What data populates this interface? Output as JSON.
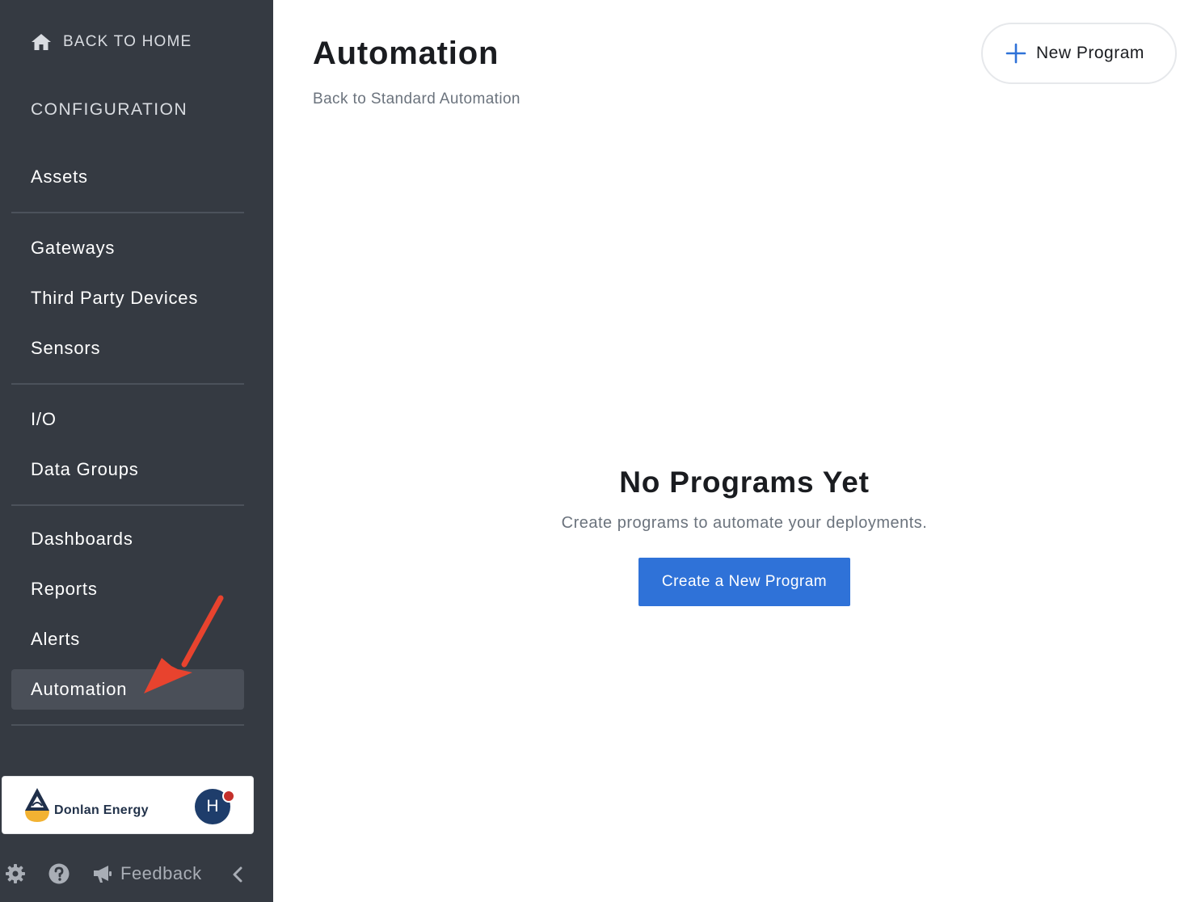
{
  "sidebar": {
    "back_home": {
      "label": "BACK TO HOME",
      "icon": "home-icon"
    },
    "section_title": "CONFIGURATION",
    "items": [
      {
        "label": "Assets"
      },
      {
        "label": "Gateways"
      },
      {
        "label": "Third Party Devices"
      },
      {
        "label": "Sensors"
      },
      {
        "label": "I/O"
      },
      {
        "label": "Data Groups"
      },
      {
        "label": "Dashboards"
      },
      {
        "label": "Reports"
      },
      {
        "label": "Alerts"
      },
      {
        "label": "Automation",
        "active": true
      }
    ],
    "org": {
      "name": "Donlan Energy",
      "avatar_initial": "H"
    },
    "footer": {
      "feedback_label": "Feedback",
      "icons": [
        "gear-icon",
        "help-icon",
        "megaphone-icon",
        "chevron-left-icon"
      ]
    }
  },
  "main": {
    "title": "Automation",
    "back_link": "Back to Standard Automation",
    "new_program_button": {
      "label": "New Program",
      "icon": "plus-icon"
    },
    "empty_state": {
      "title": "No Programs Yet",
      "subtitle": "Create programs to automate your deployments.",
      "button_label": "Create a New Program"
    }
  },
  "colors": {
    "sidebar_bg": "#353a42",
    "active_item_bg": "#4a4f58",
    "primary": "#2f72d8",
    "annotation_arrow": "#e8432e"
  }
}
